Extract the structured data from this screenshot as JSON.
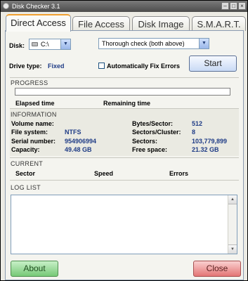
{
  "window": {
    "title": "Disk Checker 3.1"
  },
  "tabs": [
    {
      "label": "Direct Access"
    },
    {
      "label": "File Access"
    },
    {
      "label": "Disk Image"
    },
    {
      "label": "S.M.A.R.T."
    }
  ],
  "disk": {
    "label": "Disk:",
    "value": "C:\\"
  },
  "check_mode": {
    "value": "Thorough check (both above)"
  },
  "drive_type": {
    "label": "Drive type:",
    "value": "Fixed"
  },
  "auto_fix": {
    "label": "Automatically Fix Errors",
    "checked": false
  },
  "start_label": "Start",
  "progress": {
    "title": "PROGRESS",
    "percent": 0,
    "elapsed_label": "Elapsed time",
    "remaining_label": "Remaining time"
  },
  "information": {
    "title": "INFORMATION",
    "volume_label": "Volume name:",
    "volume_value": "",
    "fs_label": "File system:",
    "fs_value": "NTFS",
    "serial_label": "Serial number:",
    "serial_value": "954906994",
    "capacity_label": "Capacity:",
    "capacity_value": "49.48 GB",
    "bps_label": "Bytes/Sector:",
    "bps_value": "512",
    "spc_label": "Sectors/Cluster:",
    "spc_value": "8",
    "sectors_label": "Sectors:",
    "sectors_value": "103,779,899",
    "free_label": "Free space:",
    "free_value": "21.32 GB"
  },
  "current": {
    "title": "CURRENT",
    "sector_label": "Sector",
    "speed_label": "Speed",
    "errors_label": "Errors"
  },
  "log": {
    "title": "LOG LIST"
  },
  "footer": {
    "about_label": "About",
    "close_label": "Close"
  },
  "colors": {
    "value_text": "#1f3c86",
    "about": "#7fd07f",
    "close": "#e87b7b",
    "active_tab": "#f0a030"
  }
}
